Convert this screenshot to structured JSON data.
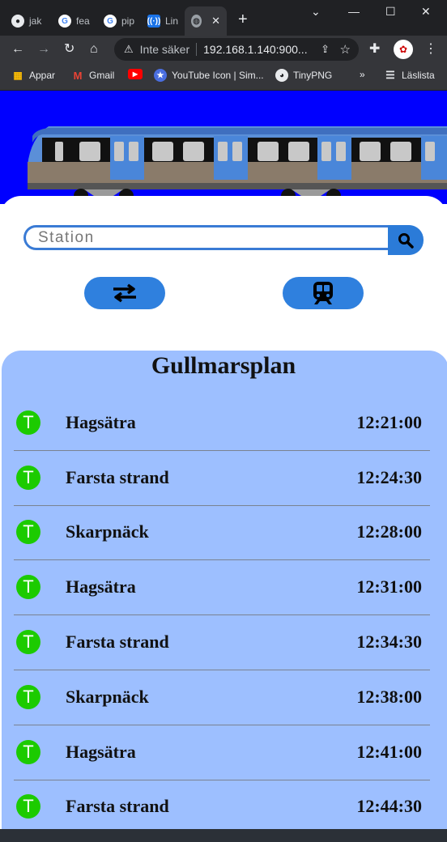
{
  "browser": {
    "tabs": [
      {
        "icon": "github-icon",
        "label": "jak"
      },
      {
        "icon": "google-icon",
        "label": "fea"
      },
      {
        "icon": "google-icon",
        "label": "pip"
      },
      {
        "icon": "radio-icon",
        "label": "Lin"
      },
      {
        "icon": "globe-icon",
        "label": ""
      }
    ],
    "address": {
      "security": "Inte säker",
      "url": "192.168.1.140:900..."
    },
    "bookmarks": {
      "apps": "Appar",
      "gmail": "Gmail",
      "youtube_icon": "YouTube Icon | Sim...",
      "tinypng": "TinyPNG",
      "more": "»",
      "reading_list": "Läslista"
    }
  },
  "app": {
    "search": {
      "placeholder": "Station",
      "value": ""
    },
    "colors": {
      "hero": "#0000ff",
      "board": "#9dbfff",
      "button": "#2f80de",
      "line_badge": "#1ccb00"
    },
    "board": {
      "title": "Gullmarsplan",
      "departures": [
        {
          "line": "T",
          "destination": "Hagsätra",
          "time": "12:21:00"
        },
        {
          "line": "T",
          "destination": "Farsta strand",
          "time": "12:24:30"
        },
        {
          "line": "T",
          "destination": "Skarpnäck",
          "time": "12:28:00"
        },
        {
          "line": "T",
          "destination": "Hagsätra",
          "time": "12:31:00"
        },
        {
          "line": "T",
          "destination": "Farsta strand",
          "time": "12:34:30"
        },
        {
          "line": "T",
          "destination": "Skarpnäck",
          "time": "12:38:00"
        },
        {
          "line": "T",
          "destination": "Hagsätra",
          "time": "12:41:00"
        },
        {
          "line": "T",
          "destination": "Farsta strand",
          "time": "12:44:30"
        }
      ]
    }
  }
}
